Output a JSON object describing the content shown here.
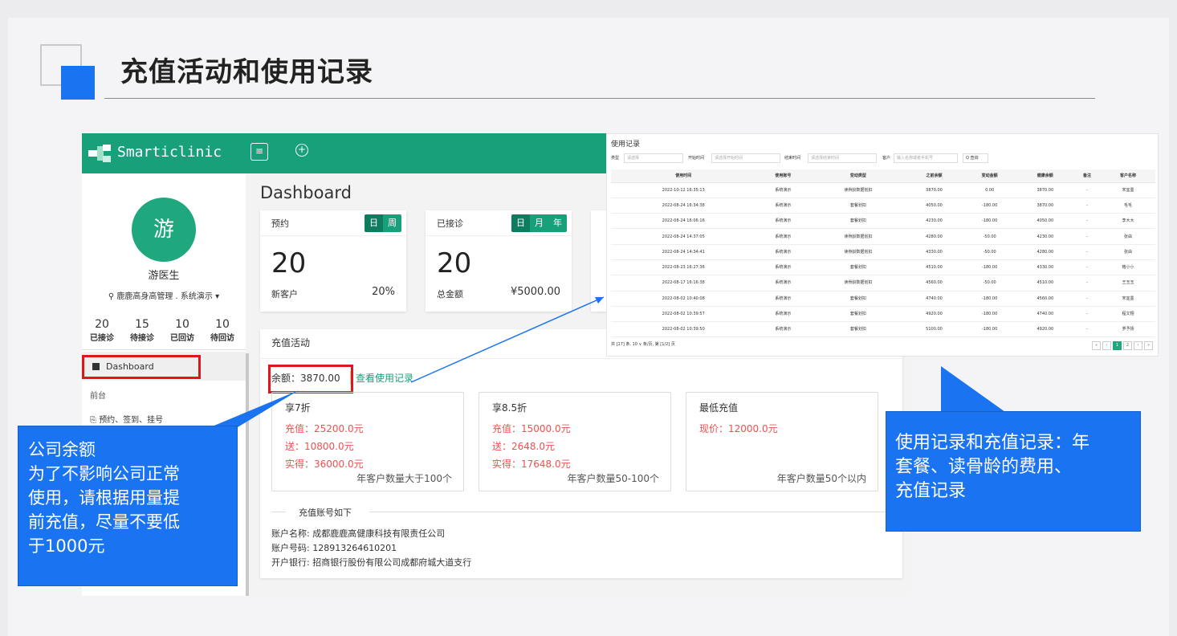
{
  "slide": {
    "title": "充值活动和使用记录"
  },
  "app": {
    "logo_text": "Smarticlinic",
    "menu_icon": "menu-icon",
    "add_icon": "plus-circle-icon",
    "sidebar": {
      "avatar_char": "游",
      "doctor_name": "游医生",
      "org": "⚲ 鹿鹿高身高管理 . 系统演示 ▾",
      "stats": [
        {
          "num": "20",
          "label": "已接诊"
        },
        {
          "num": "15",
          "label": "待接诊"
        },
        {
          "num": "10",
          "label": "已回访"
        },
        {
          "num": "10",
          "label": "待回访"
        }
      ],
      "dashboard_label": "Dashboard",
      "section_label": "前台",
      "item_label": "预约、签到、挂号"
    },
    "main": {
      "title": "Dashboard",
      "cards": [
        {
          "label": "预约",
          "seg": [
            "日",
            "周"
          ],
          "value": "20",
          "sub_label": "新客户",
          "sub_value": "20%"
        },
        {
          "label": "已接诊",
          "seg": [
            "日",
            "月",
            "年"
          ],
          "value": "20",
          "sub_label": "总金额",
          "sub_value": "¥5000.00"
        }
      ],
      "recharge": {
        "title": "充值活动",
        "balance": "余额：3870.00",
        "view_link": "查看使用记录",
        "packages": [
          {
            "title": "享7折",
            "lines": [
              "充值：25200.0元",
              "送：10800.0元",
              "实得：36000.0元"
            ],
            "foot": "年客户数量大于100个"
          },
          {
            "title": "享8.5折",
            "lines": [
              "充值：15000.0元",
              "送：2648.0元",
              "实得：17648.0元"
            ],
            "foot": "年客户数量50-100个"
          },
          {
            "title": "最低充值",
            "lines": [
              "现价：12000.0元"
            ],
            "foot": "年客户数量50个以内"
          }
        ],
        "account_header": "充值账号如下",
        "account_name": "账户名称: 成都鹿鹿高健康科技有限责任公司",
        "account_no": "账户号码: 128913264610201",
        "bank": "开户银行: 招商银行股份有限公司成都府城大道支行"
      }
    }
  },
  "usage": {
    "title": "使用记录",
    "filters": {
      "type_label": "类型",
      "type_placeholder": "请选择",
      "start_label": "开始时间",
      "start_placeholder": "请选择开始时间",
      "end_label": "结束时间",
      "end_placeholder": "请选择结束时间",
      "client_label": "客户",
      "client_placeholder": "输入名称或者手机号",
      "query_button": "Q 查询"
    },
    "columns": [
      "使用时间",
      "使用账号",
      "变动类型",
      "之前余额",
      "变动金额",
      "健康余额",
      "备注",
      "客户名称"
    ],
    "rows": [
      [
        "2022-10-12 16:35:13",
        "系统演示",
        "读骨龄数据划扣",
        "3870.00",
        "0.00",
        "3870.00",
        "-",
        "宋宜墨"
      ],
      [
        "2022-08-24 16:34:38",
        "系统演示",
        "套餐划扣",
        "4050.00",
        "-180.00",
        "3870.00",
        "-",
        "毛毛"
      ],
      [
        "2022-08-24 16:06:16",
        "系统演示",
        "套餐划扣",
        "4230.00",
        "-180.00",
        "4050.00",
        "-",
        "李大大"
      ],
      [
        "2022-08-24 14:37:05",
        "系统演示",
        "读骨龄数据划扣",
        "4280.00",
        "-50.00",
        "4230.00",
        "-",
        "张由"
      ],
      [
        "2022-08-24 14:34:41",
        "系统演示",
        "读骨龄数据划扣",
        "4330.00",
        "-50.00",
        "4280.00",
        "-",
        "张由"
      ],
      [
        "2022-08-23 16:27:36",
        "系统演示",
        "套餐划扣",
        "4510.00",
        "-180.00",
        "4330.00",
        "-",
        "格小小"
      ],
      [
        "2022-08-17 16:16:38",
        "系统演示",
        "读骨龄数据划扣",
        "4560.00",
        "-50.00",
        "4510.00",
        "-",
        "王玉玉"
      ],
      [
        "2022-08-02 10:40:08",
        "系统演示",
        "套餐划扣",
        "4740.00",
        "-180.00",
        "4560.00",
        "-",
        "宋宜墨"
      ],
      [
        "2022-08-02 10:39:57",
        "系统演示",
        "套餐划扣",
        "4920.00",
        "-180.00",
        "4740.00",
        "-",
        "程文翔"
      ],
      [
        "2022-08-02 10:39:50",
        "系统演示",
        "套餐划扣",
        "5100.00",
        "-180.00",
        "4920.00",
        "-",
        "罗予扬"
      ]
    ],
    "footer": "共 [17] 条,  10 ∨ 条/页,  第 [1/2] 页",
    "pager": [
      "«",
      "‹",
      "1",
      "2",
      "›",
      "»"
    ]
  },
  "callouts": {
    "left": [
      "公司余额",
      "为了不影响公司正常",
      "使用，请根据用量提",
      "前充值，尽量不要低",
      "于1000元"
    ],
    "right": [
      "使用记录和充值记录：年",
      "套餐、读骨龄的费用、",
      "充值记录"
    ]
  },
  "colors": {
    "accent": "#1a73f0",
    "brand_green": "#17a07a",
    "highlight_red": "#e0161b",
    "price_red": "#f05050"
  }
}
